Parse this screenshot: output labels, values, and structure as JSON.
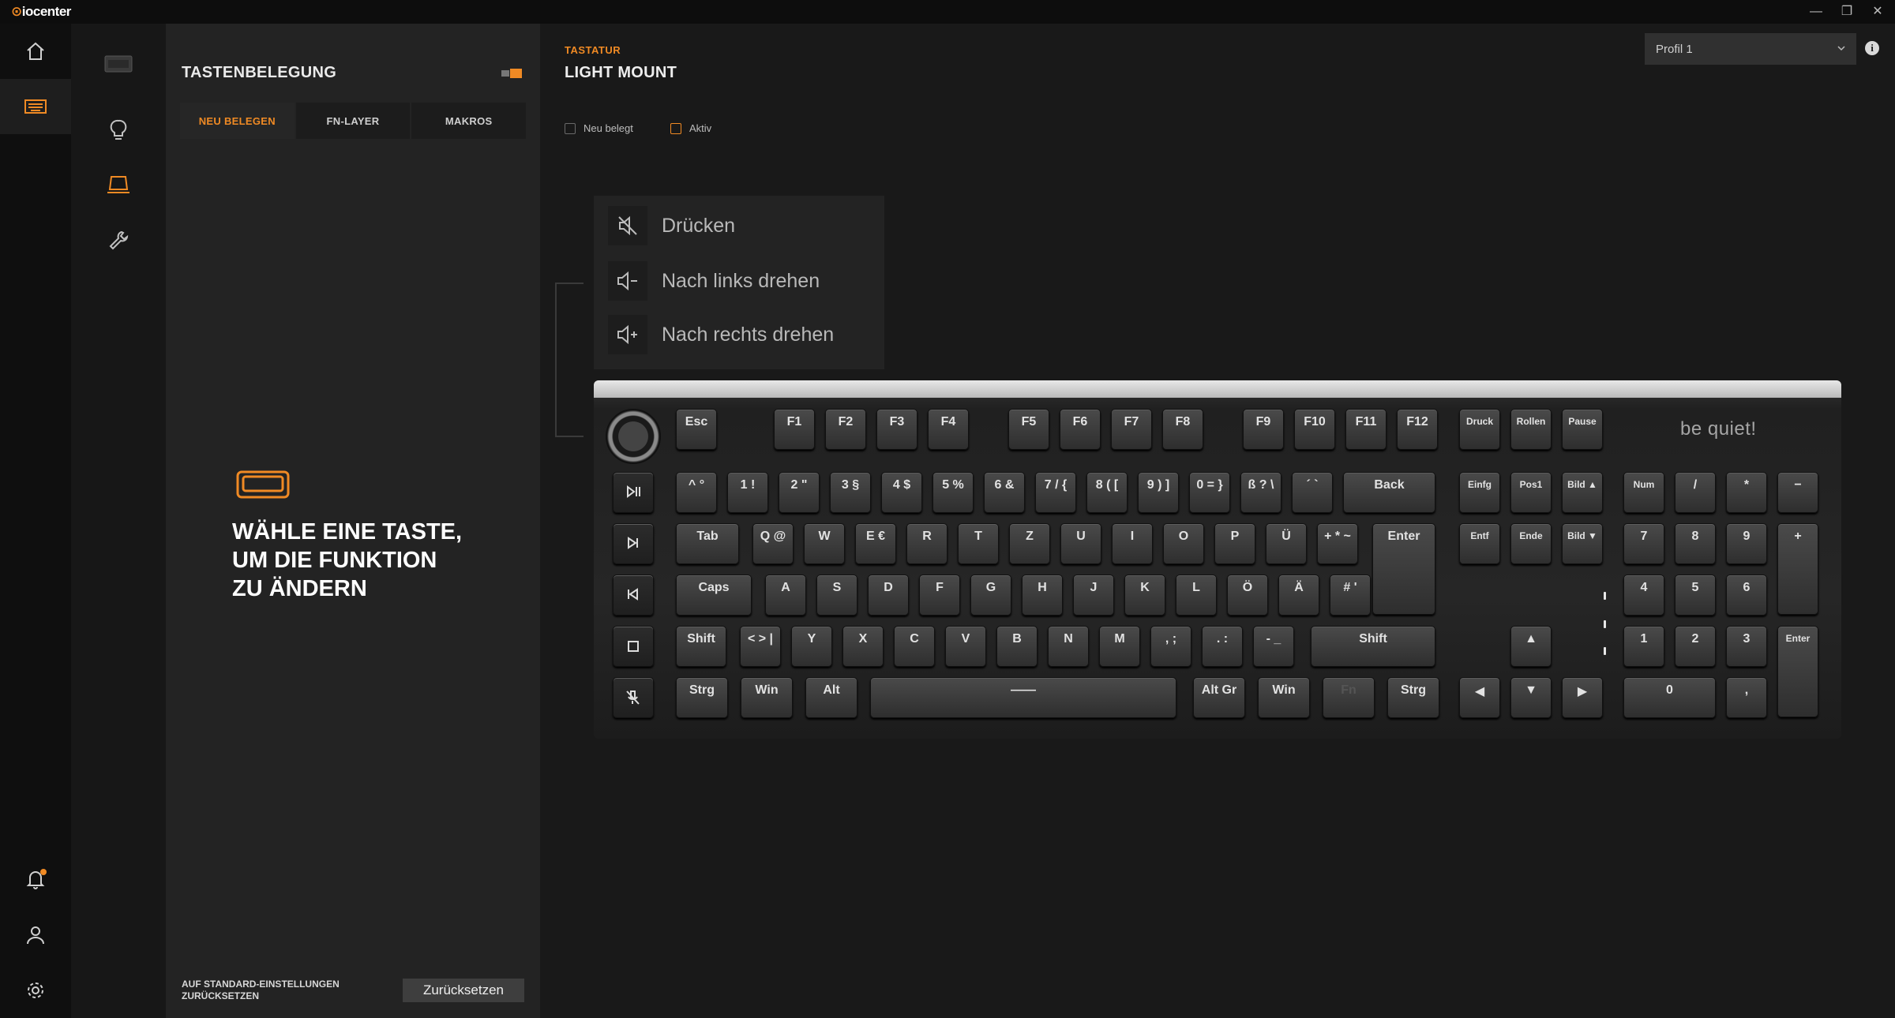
{
  "app": {
    "name_prefix": "io",
    "name_suffix": "center",
    "window_controls": [
      "—",
      "❐",
      "✕"
    ]
  },
  "rail": {
    "items": [
      "home-icon",
      "keyboard-icon"
    ],
    "bottom": [
      "bell-icon",
      "user-icon",
      "settings-icon"
    ]
  },
  "subnav": {
    "items": [
      "keyboard-preview-icon",
      "lightbulb-icon",
      "keyboard-remap-icon",
      "wrench-icon"
    ]
  },
  "panel": {
    "title": "TASTENBELEGUNG",
    "tabs": [
      {
        "label": "NEU BELEGEN",
        "active": true
      },
      {
        "label": "FN-LAYER",
        "active": false
      },
      {
        "label": "MAKROS",
        "active": false
      }
    ],
    "prompt": "WÄHLE EINE TASTE,\nUM DIE FUNKTION\nZU ÄNDERN",
    "reset_label": "AUF STANDARD-EINSTELLUNGEN\nZURÜCKSETZEN",
    "reset_button": "Zurücksetzen"
  },
  "main": {
    "category": "TASTATUR",
    "title": "LIGHT MOUNT",
    "legend": [
      {
        "label": "Neu belegt",
        "color": "#6a6a6a"
      },
      {
        "label": "Aktiv",
        "color": "#f08a24"
      }
    ],
    "profile": "Profil 1",
    "info": "i"
  },
  "knob_menu": [
    {
      "label": "Drücken",
      "icon": "mute-speaker-icon"
    },
    {
      "label": "Nach links drehen",
      "icon": "volume-down-icon"
    },
    {
      "label": "Nach rechts drehen",
      "icon": "volume-up-icon"
    }
  ],
  "keyboard": {
    "brand": "be quiet!",
    "space_label": "——",
    "fn_row": [
      "Esc",
      "F1",
      "F2",
      "F3",
      "F4",
      "F5",
      "F6",
      "F7",
      "F8",
      "F9",
      "F10",
      "F11",
      "F12",
      "Druck",
      "Rollen",
      "Pause"
    ],
    "number_row": [
      "^ °",
      "1 !",
      "2 \"",
      "3 §",
      "4 $",
      "5 %",
      "6 &",
      "7 / {",
      "8 ( [",
      "9 ) ]",
      "0 = }",
      "ß ? \\",
      "´ `",
      "Back"
    ],
    "nav_row1": [
      "Einfg",
      "Pos1",
      "Bild ▲"
    ],
    "numpad_row1": [
      "Num",
      "/",
      "*",
      "−"
    ],
    "tab_row": [
      "Tab",
      "Q @",
      "W",
      "E €",
      "R",
      "T",
      "Z",
      "U",
      "I",
      "O",
      "P",
      "Ü",
      "+ * ~",
      "Enter"
    ],
    "nav_row2": [
      "Entf",
      "Ende",
      "Bild ▼"
    ],
    "numpad_row2": [
      "7",
      "8",
      "9",
      "+"
    ],
    "caps_row": [
      "Caps",
      "A",
      "S",
      "D",
      "F",
      "G",
      "H",
      "J",
      "K",
      "L",
      "Ö",
      "Ä",
      "# '"
    ],
    "numpad_row3": [
      "4",
      "5",
      "6"
    ],
    "shift_row": [
      "Shift",
      "< > |",
      "Y",
      "X",
      "C",
      "V",
      "B",
      "N",
      "M",
      ", ;",
      ". :",
      "- _",
      "Shift"
    ],
    "arrow_up": "▲",
    "numpad_row4": [
      "1",
      "2",
      "3",
      "Enter"
    ],
    "bottom_row": [
      "Strg",
      "Win",
      "Alt",
      "Alt Gr",
      "Win",
      "Fn",
      "Strg"
    ],
    "arrows": [
      "◀",
      "▼",
      "▶"
    ],
    "numpad_row5": [
      "0",
      ","
    ],
    "media_keys": [
      "play-pause-icon",
      "next-track-icon",
      "previous-track-icon",
      "stop-icon",
      "mute-mic-icon"
    ]
  }
}
